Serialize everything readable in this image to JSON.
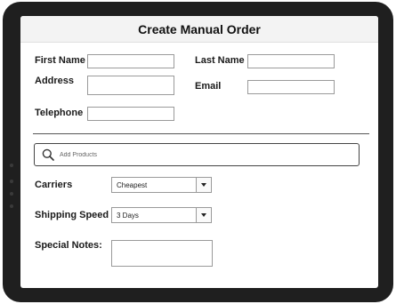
{
  "form": {
    "title": "Create Manual Order",
    "first_name": {
      "label": "First Name",
      "value": ""
    },
    "last_name": {
      "label": "Last Name",
      "value": ""
    },
    "address": {
      "label": "Address",
      "value": ""
    },
    "email": {
      "label": "Email",
      "value": ""
    },
    "telephone": {
      "label": "Telephone",
      "value": ""
    },
    "add_products": {
      "placeholder": "Add Products",
      "icon": "search-icon"
    },
    "carriers": {
      "label": "Carriers",
      "selected": "Cheapest"
    },
    "shipping_speed": {
      "label": "Shipping Speed",
      "selected": "3 Days"
    },
    "special_notes": {
      "label": "Special Notes:",
      "value": ""
    }
  },
  "colors": {
    "device_frame": "#1f1f1f",
    "border": "#9a9a9a",
    "text": "#1a1a1a"
  }
}
